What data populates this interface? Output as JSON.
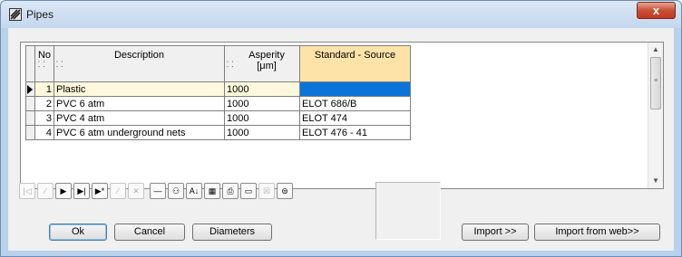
{
  "window": {
    "title": "Pipes",
    "close_label": "x"
  },
  "grid": {
    "columns": {
      "no": "No",
      "description": "Description",
      "asperity_line1": "Asperity",
      "asperity_line2": "[μm]",
      "standard": "Standard - Source"
    },
    "rows": [
      {
        "no": "1",
        "description": "Plastic",
        "asperity": "1000",
        "standard": ""
      },
      {
        "no": "2",
        "description": "PVC 6 atm",
        "asperity": "1000",
        "standard": "ELOT 686/B"
      },
      {
        "no": "3",
        "description": "PVC 4 atm",
        "asperity": "1000",
        "standard": "ELOT 474"
      },
      {
        "no": "4",
        "description": "PVC 6 atm underground nets",
        "asperity": "1000",
        "standard": "ELOT 476 - 41"
      }
    ],
    "current_row": 1
  },
  "navigator": {
    "buttons": [
      {
        "icon": "first-record-icon",
        "glyph": "|◁",
        "enabled": false
      },
      {
        "icon": "prior-record-icon",
        "glyph": "∕",
        "enabled": false
      },
      {
        "icon": "next-record-icon",
        "glyph": "▶",
        "enabled": true
      },
      {
        "icon": "last-record-icon",
        "glyph": "▶|",
        "enabled": true
      },
      {
        "icon": "insert-record-icon",
        "glyph": "▶*",
        "enabled": true
      },
      {
        "icon": "edit-record-icon",
        "glyph": "∕",
        "enabled": false
      },
      {
        "icon": "cancel-edit-icon",
        "glyph": "✕",
        "enabled": false
      },
      {
        "icon": "delete-record-icon",
        "glyph": "—",
        "enabled": true
      },
      {
        "icon": "find-binoculars-icon",
        "glyph": "⚇",
        "enabled": true
      },
      {
        "icon": "sort-az-icon",
        "glyph": "A↓",
        "enabled": true
      },
      {
        "icon": "table-edit-icon",
        "glyph": "▦",
        "enabled": true
      },
      {
        "icon": "print-icon",
        "glyph": "⎙",
        "enabled": true
      },
      {
        "icon": "open-folder-icon",
        "glyph": "▭",
        "enabled": true
      },
      {
        "icon": "export-excel-icon",
        "glyph": "☒",
        "enabled": false
      },
      {
        "icon": "units-settings-icon",
        "glyph": "⊜",
        "enabled": true
      }
    ]
  },
  "buttons": {
    "ok": "Ok",
    "cancel": "Cancel",
    "diameters": "Diameters",
    "import": "Import >>",
    "import_web": "Import from web>>"
  }
}
